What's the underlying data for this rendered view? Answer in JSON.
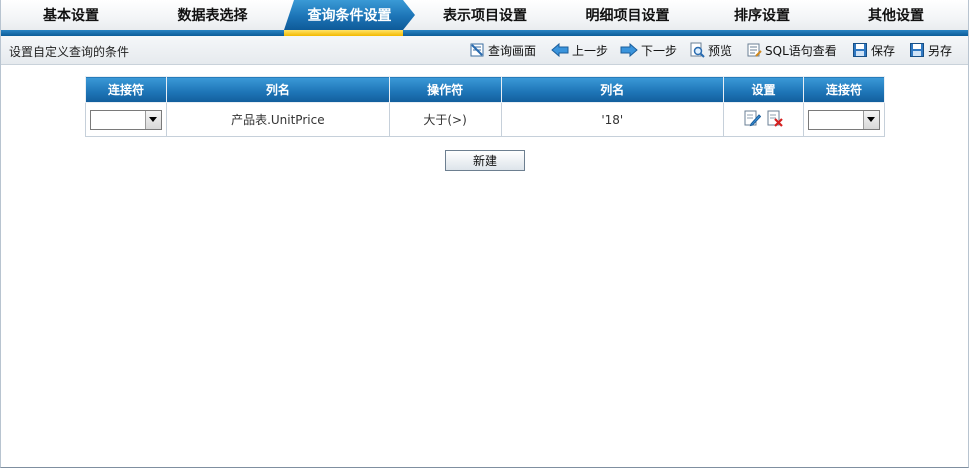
{
  "tabs": [
    {
      "label": "基本设置",
      "active": false
    },
    {
      "label": "数据表选择",
      "active": false
    },
    {
      "label": "查询条件设置",
      "active": true
    },
    {
      "label": "表示项目设置",
      "active": false
    },
    {
      "label": "明细项目设置",
      "active": false
    },
    {
      "label": "排序设置",
      "active": false
    },
    {
      "label": "其他设置",
      "active": false
    }
  ],
  "toolbar": {
    "hint": "设置自定义查询的条件",
    "query_screen": "查询画面",
    "prev_step": "上一步",
    "next_step": "下一步",
    "preview": "预览",
    "sql_view": "SQL语句查看",
    "save": "保存",
    "save_as": "另存"
  },
  "grid": {
    "headers": [
      "连接符",
      "列名",
      "操作符",
      "列名",
      "设置",
      "连接符"
    ],
    "rows": [
      {
        "connector_left": "",
        "column": "产品表.UnitPrice",
        "operator": "大于(>)",
        "value": "'18'",
        "connector_right": ""
      }
    ]
  },
  "new_button": "新建",
  "colors": {
    "accent": "#1c74b6",
    "highlight": "#f2b800"
  }
}
